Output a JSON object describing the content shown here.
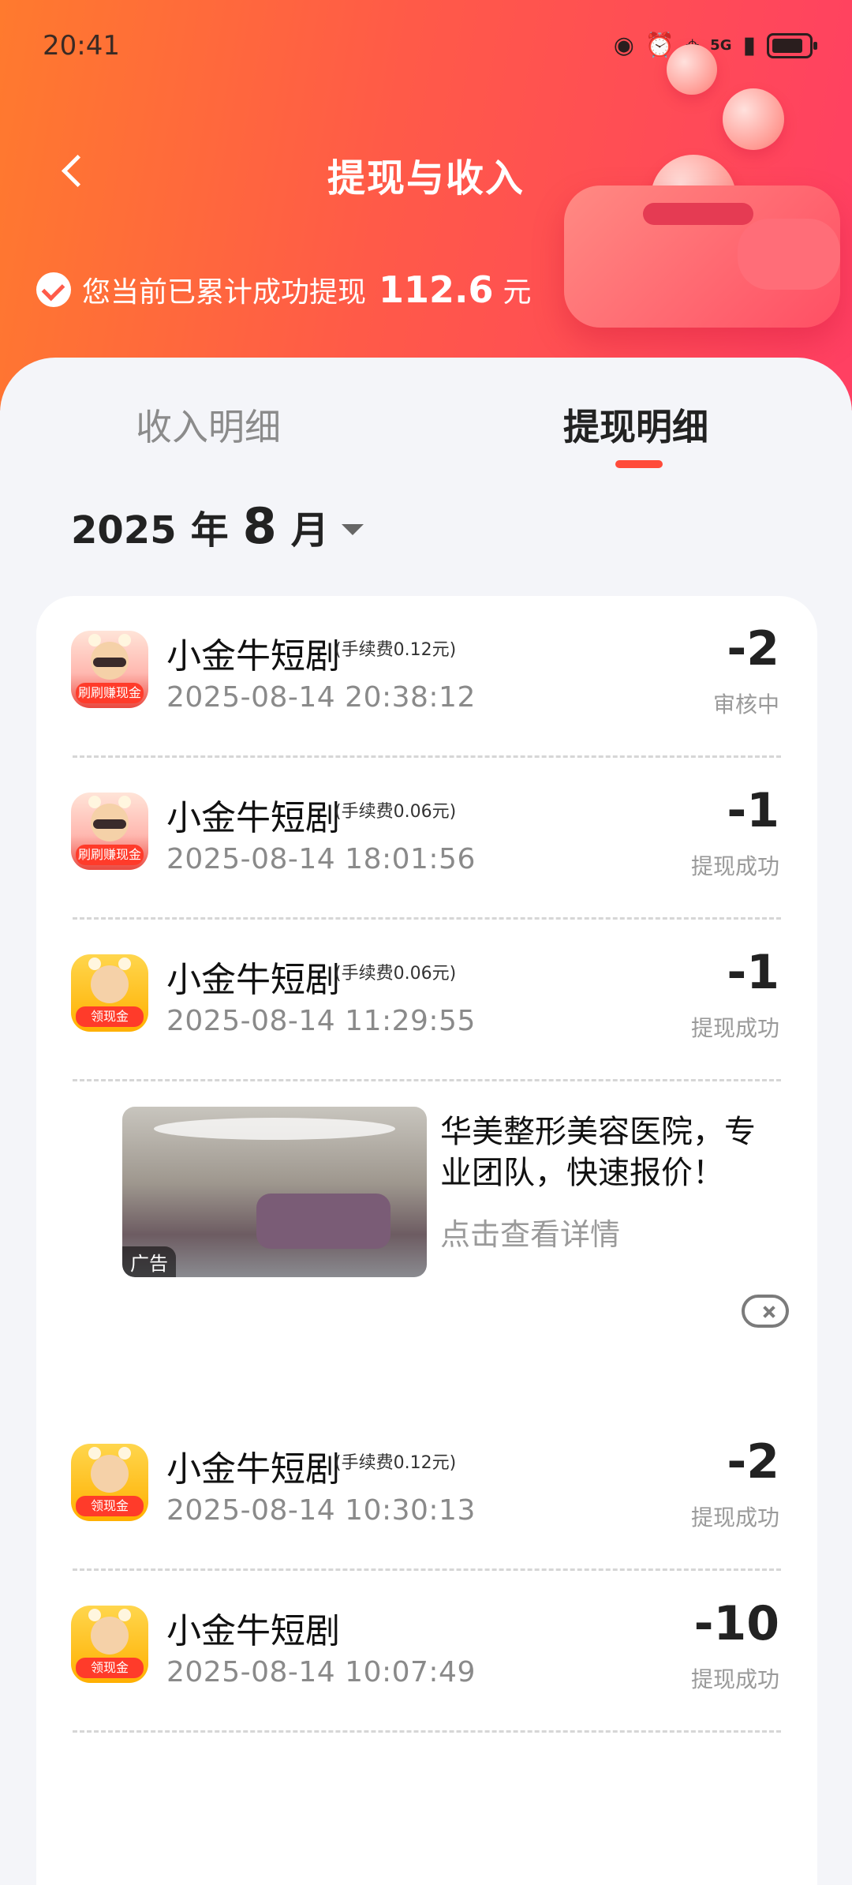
{
  "status_bar": {
    "time": "20:41",
    "network": "5G"
  },
  "header": {
    "title": "提现与收入",
    "back_icon": "chevron-left-icon"
  },
  "summary": {
    "text": "您当前已累计成功提现",
    "amount": "112.6",
    "unit": "元"
  },
  "tabs": [
    {
      "label": "收入明细",
      "active": false
    },
    {
      "label": "提现明细",
      "active": true
    }
  ],
  "month_filter": {
    "year": "2025",
    "year_label": "年",
    "month": "8",
    "month_label": "月"
  },
  "records": [
    {
      "name": "小金牛短剧",
      "fee": "(手续费0.12元)",
      "time": "2025-08-14 20:38:12",
      "amount": "-2",
      "status": "审核中",
      "icon_badge": "刷刷赚现金"
    },
    {
      "name": "小金牛短剧",
      "fee": "(手续费0.06元)",
      "time": "2025-08-14 18:01:56",
      "amount": "-1",
      "status": "提现成功",
      "icon_badge": "刷刷赚现金"
    },
    {
      "name": "小金牛短剧",
      "fee": "(手续费0.06元)",
      "time": "2025-08-14 11:29:55",
      "amount": "-1",
      "status": "提现成功",
      "icon_badge": "领现金"
    },
    {
      "name": "小金牛短剧",
      "fee": "(手续费0.12元)",
      "time": "2025-08-14 10:30:13",
      "amount": "-2",
      "status": "提现成功",
      "icon_badge": "领现金"
    },
    {
      "name": "小金牛短剧",
      "fee": "",
      "time": "2025-08-14 10:07:49",
      "amount": "-10",
      "status": "提现成功",
      "icon_badge": "领现金"
    }
  ],
  "ad": {
    "tag": "广告",
    "title_line_1": "华美整形美容医院，专",
    "title_line_2": "业团队，快速报价！",
    "link": "点击查看详情"
  },
  "colors": {
    "accent": "#ff4b3a",
    "hero_start": "#ff7a2e",
    "hero_end": "#ff3f63"
  }
}
